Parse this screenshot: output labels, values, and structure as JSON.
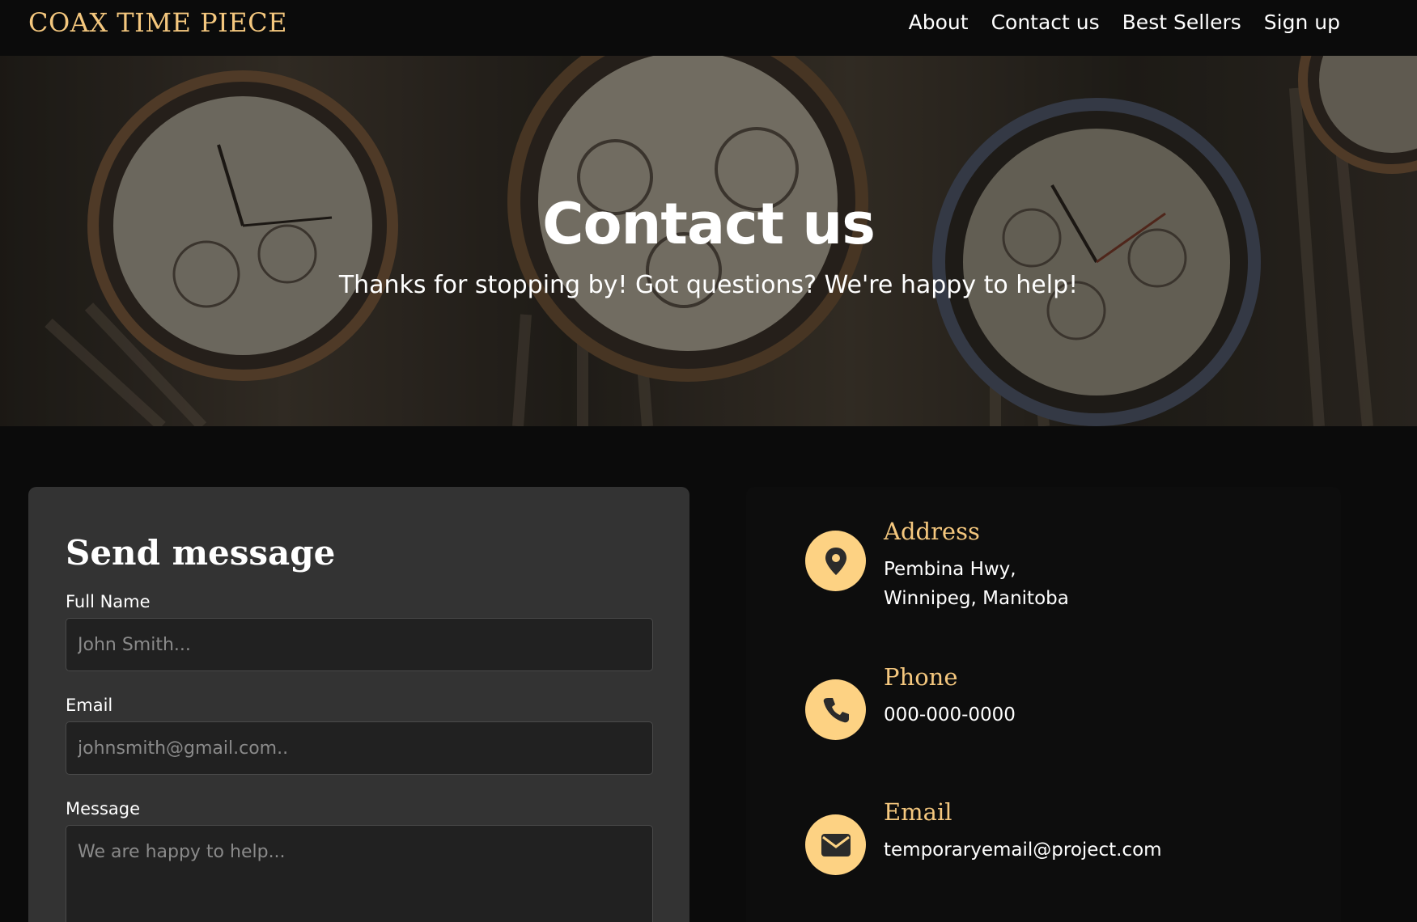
{
  "navbar": {
    "brand": "COAX TIME PIECE",
    "links": [
      {
        "label": "About"
      },
      {
        "label": "Contact us"
      },
      {
        "label": "Best Sellers"
      },
      {
        "label": "Sign up"
      }
    ]
  },
  "hero": {
    "title": "Contact us",
    "subtitle": "Thanks for stopping by! Got questions? We're happy to help!"
  },
  "form": {
    "title": "Send message",
    "full_name": {
      "label": "Full Name",
      "placeholder": "John Smith..."
    },
    "email": {
      "label": "Email",
      "placeholder": "johnsmith@gmail.com.."
    },
    "message": {
      "label": "Message",
      "placeholder": "We are happy to help..."
    }
  },
  "contact": {
    "address": {
      "title": "Address",
      "line1": "Pembina Hwy,",
      "line2": "Winnipeg, Manitoba",
      "icon": "map-pin-icon"
    },
    "phone": {
      "title": "Phone",
      "value": "000-000-0000",
      "icon": "phone-icon"
    },
    "email": {
      "title": "Email",
      "value": "temporaryemail@project.com",
      "icon": "envelope-icon"
    }
  },
  "colors": {
    "accent": "#f4c77e",
    "icon_bg": "#fdd283",
    "background": "#0b0b0b",
    "card": "#333333"
  }
}
